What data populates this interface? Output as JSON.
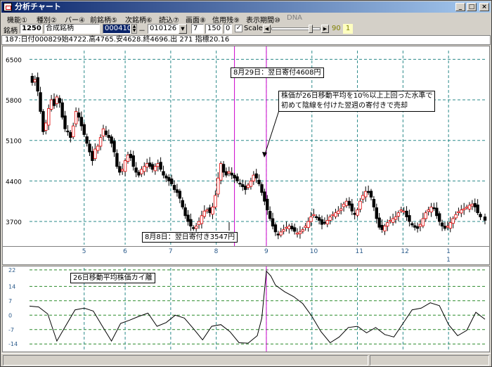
{
  "window": {
    "title": "分析チャート",
    "controls": [
      "_",
      "□",
      "×"
    ]
  },
  "menu": [
    {
      "label": "機能①",
      "disabled": false
    },
    {
      "label": "種別②",
      "disabled": false
    },
    {
      "label": "バー④",
      "disabled": false
    },
    {
      "label": "前銘柄⑤",
      "disabled": false
    },
    {
      "label": "次銘柄⑥",
      "disabled": false
    },
    {
      "label": "読込⑦",
      "disabled": false
    },
    {
      "label": "画面⑧",
      "disabled": false
    },
    {
      "label": "信用残⑨",
      "disabled": false
    },
    {
      "label": "表示期間⑩",
      "disabled": false
    },
    {
      "label": "DNA",
      "disabled": true
    }
  ],
  "toolbar": {
    "code_label": "銘柄",
    "code_value": "1250",
    "name_value": "合成銘柄",
    "start_value": "000410",
    "dash": "－",
    "end_value": "010126",
    "period_value": "7",
    "count_value": "1500",
    "offset_value": "0",
    "scale_checked": "✓",
    "scale_label": "Scale",
    "slider_value": "90",
    "slider_fraction": 0.83,
    "badge": "1"
  },
  "info_line": "187:日付000829始4722.高4765.安4628.終4696.出 271 指標20.16",
  "notes": {
    "aug29": "8月29日：翌日寄付4608円",
    "signal_line1": "株価が26日移動平均を10％以上上回った水準で",
    "signal_line2": "初めて陰線を付けた翌週の寄付きで売却",
    "aug8": "8月8日：翌日寄付き3547円",
    "indicator": "26日移動平均株価カイ離"
  },
  "chart_data": [
    {
      "type": "candlestick",
      "y_tick_labels": [
        "6500",
        "5800",
        "5100",
        "4400",
        "3700"
      ],
      "y_ticks": [
        6500,
        5800,
        5100,
        4400,
        3700
      ],
      "ylim": [
        3300,
        6650
      ],
      "x_tick_labels": [
        "5",
        "6",
        "7",
        "8",
        "9",
        "10",
        "11",
        "12",
        "1"
      ],
      "x_tick_positions": [
        0.12,
        0.21,
        0.31,
        0.41,
        0.52,
        0.62,
        0.72,
        0.82,
        0.92
      ],
      "year_label": "1",
      "grid": true,
      "markers": [
        {
          "name": "buy",
          "date": "8月8日",
          "x": 0.45
        },
        {
          "name": "sell",
          "date": "8月29日",
          "x": 0.52
        }
      ],
      "close_path": [
        [
          0.0,
          6220
        ],
        [
          0.006,
          6100
        ],
        [
          0.012,
          6150
        ],
        [
          0.018,
          5950
        ],
        [
          0.024,
          5600
        ],
        [
          0.03,
          5250
        ],
        [
          0.036,
          5400
        ],
        [
          0.042,
          5650
        ],
        [
          0.048,
          5800
        ],
        [
          0.054,
          5700
        ],
        [
          0.06,
          5850
        ],
        [
          0.066,
          5750
        ],
        [
          0.072,
          5500
        ],
        [
          0.078,
          5300
        ],
        [
          0.084,
          5250
        ],
        [
          0.09,
          5150
        ],
        [
          0.096,
          5350
        ],
        [
          0.102,
          5600
        ],
        [
          0.108,
          5500
        ],
        [
          0.114,
          5350
        ],
        [
          0.12,
          5200
        ],
        [
          0.126,
          5050
        ],
        [
          0.132,
          4900
        ],
        [
          0.138,
          4750
        ],
        [
          0.144,
          4950
        ],
        [
          0.15,
          5000
        ],
        [
          0.156,
          5150
        ],
        [
          0.162,
          5300
        ],
        [
          0.168,
          5200
        ],
        [
          0.174,
          5150
        ],
        [
          0.18,
          5050
        ],
        [
          0.186,
          4900
        ],
        [
          0.192,
          4650
        ],
        [
          0.198,
          4550
        ],
        [
          0.204,
          4600
        ],
        [
          0.21,
          4750
        ],
        [
          0.216,
          4850
        ],
        [
          0.222,
          4800
        ],
        [
          0.228,
          4650
        ],
        [
          0.234,
          4550
        ],
        [
          0.24,
          4500
        ],
        [
          0.246,
          4600
        ],
        [
          0.252,
          4650
        ],
        [
          0.258,
          4700
        ],
        [
          0.264,
          4650
        ],
        [
          0.27,
          4600
        ],
        [
          0.276,
          4650
        ],
        [
          0.282,
          4700
        ],
        [
          0.288,
          4600
        ],
        [
          0.294,
          4500
        ],
        [
          0.3,
          4450
        ],
        [
          0.306,
          4400
        ],
        [
          0.312,
          4350
        ],
        [
          0.318,
          4250
        ],
        [
          0.324,
          4200
        ],
        [
          0.33,
          4100
        ],
        [
          0.336,
          3950
        ],
        [
          0.342,
          3800
        ],
        [
          0.348,
          3700
        ],
        [
          0.354,
          3620
        ],
        [
          0.36,
          3580
        ],
        [
          0.366,
          3620
        ],
        [
          0.372,
          3700
        ],
        [
          0.378,
          3800
        ],
        [
          0.384,
          3880
        ],
        [
          0.39,
          3900
        ],
        [
          0.396,
          3850
        ],
        [
          0.402,
          3950
        ],
        [
          0.408,
          4150
        ],
        [
          0.414,
          4450
        ],
        [
          0.42,
          4700
        ],
        [
          0.426,
          4550
        ],
        [
          0.432,
          4500
        ],
        [
          0.438,
          4560
        ],
        [
          0.444,
          4500
        ],
        [
          0.45,
          4450
        ],
        [
          0.456,
          4400
        ],
        [
          0.462,
          4350
        ],
        [
          0.468,
          4300
        ],
        [
          0.474,
          4250
        ],
        [
          0.48,
          4330
        ],
        [
          0.486,
          4400
        ],
        [
          0.492,
          4500
        ],
        [
          0.498,
          4450
        ],
        [
          0.504,
          4350
        ],
        [
          0.51,
          4200
        ],
        [
          0.516,
          4050
        ],
        [
          0.522,
          3900
        ],
        [
          0.528,
          3750
        ],
        [
          0.534,
          3620
        ],
        [
          0.54,
          3520
        ],
        [
          0.546,
          3480
        ],
        [
          0.552,
          3520
        ],
        [
          0.558,
          3560
        ],
        [
          0.564,
          3600
        ],
        [
          0.57,
          3620
        ],
        [
          0.576,
          3570
        ],
        [
          0.582,
          3530
        ],
        [
          0.588,
          3500
        ],
        [
          0.594,
          3520
        ],
        [
          0.6,
          3560
        ],
        [
          0.606,
          3620
        ],
        [
          0.612,
          3700
        ],
        [
          0.618,
          3780
        ],
        [
          0.624,
          3820
        ],
        [
          0.63,
          3780
        ],
        [
          0.636,
          3720
        ],
        [
          0.642,
          3650
        ],
        [
          0.648,
          3680
        ],
        [
          0.654,
          3720
        ],
        [
          0.66,
          3780
        ],
        [
          0.666,
          3820
        ],
        [
          0.672,
          3850
        ],
        [
          0.678,
          3880
        ],
        [
          0.684,
          3920
        ],
        [
          0.69,
          4000
        ],
        [
          0.696,
          4050
        ],
        [
          0.702,
          3980
        ],
        [
          0.708,
          3880
        ],
        [
          0.714,
          3820
        ],
        [
          0.72,
          3900
        ],
        [
          0.726,
          4050
        ],
        [
          0.732,
          4150
        ],
        [
          0.738,
          4220
        ],
        [
          0.744,
          4200
        ],
        [
          0.75,
          4120
        ],
        [
          0.756,
          3950
        ],
        [
          0.762,
          3750
        ],
        [
          0.768,
          3600
        ],
        [
          0.774,
          3560
        ],
        [
          0.78,
          3620
        ],
        [
          0.786,
          3680
        ],
        [
          0.792,
          3720
        ],
        [
          0.798,
          3750
        ],
        [
          0.804,
          3780
        ],
        [
          0.81,
          3850
        ],
        [
          0.816,
          3900
        ],
        [
          0.822,
          3880
        ],
        [
          0.828,
          3780
        ],
        [
          0.834,
          3700
        ],
        [
          0.84,
          3640
        ],
        [
          0.846,
          3600
        ],
        [
          0.852,
          3580
        ],
        [
          0.858,
          3650
        ],
        [
          0.864,
          3750
        ],
        [
          0.87,
          3850
        ],
        [
          0.876,
          3900
        ],
        [
          0.882,
          3950
        ],
        [
          0.888,
          3920
        ],
        [
          0.894,
          3800
        ],
        [
          0.9,
          3700
        ],
        [
          0.906,
          3620
        ],
        [
          0.912,
          3580
        ],
        [
          0.918,
          3620
        ],
        [
          0.924,
          3680
        ],
        [
          0.93,
          3750
        ],
        [
          0.936,
          3820
        ],
        [
          0.942,
          3870
        ],
        [
          0.948,
          3900
        ],
        [
          0.954,
          3920
        ],
        [
          0.96,
          3950
        ],
        [
          0.966,
          3980
        ],
        [
          0.972,
          4000
        ],
        [
          0.978,
          3950
        ],
        [
          0.984,
          3850
        ],
        [
          0.99,
          3780
        ],
        [
          1.0,
          3720
        ]
      ]
    },
    {
      "type": "line",
      "title": "26日移動平均株価カイ離",
      "y_tick_labels": [
        "22",
        "14",
        "7",
        "0",
        "-7",
        "-14"
      ],
      "y_ticks": [
        22,
        14,
        7,
        0,
        -7,
        -14
      ],
      "ylim": [
        -17,
        23
      ],
      "grid": true,
      "x": [
        0.0,
        0.02,
        0.04,
        0.06,
        0.08,
        0.1,
        0.12,
        0.14,
        0.16,
        0.18,
        0.2,
        0.22,
        0.24,
        0.26,
        0.28,
        0.3,
        0.32,
        0.34,
        0.36,
        0.38,
        0.4,
        0.42,
        0.44,
        0.46,
        0.48,
        0.5,
        0.51,
        0.52,
        0.53,
        0.54,
        0.56,
        0.58,
        0.6,
        0.62,
        0.64,
        0.66,
        0.68,
        0.7,
        0.72,
        0.74,
        0.76,
        0.78,
        0.8,
        0.82,
        0.84,
        0.86,
        0.88,
        0.9,
        0.92,
        0.94,
        0.96,
        0.98,
        1.0
      ],
      "values": [
        5,
        4,
        0,
        -12,
        -5,
        2,
        4,
        2,
        -6,
        -12,
        -4,
        -3,
        0,
        1,
        -6,
        -3,
        0,
        -2,
        -6,
        -12,
        -6,
        -4,
        -8,
        -14,
        -13,
        -10,
        -2,
        22,
        19,
        14,
        12,
        9,
        5,
        0,
        -8,
        -14,
        -10,
        -6,
        -6,
        -8,
        -6,
        -10,
        -10,
        -4,
        2,
        4,
        6,
        4,
        -4,
        -10,
        -8,
        2,
        -2
      ]
    }
  ]
}
